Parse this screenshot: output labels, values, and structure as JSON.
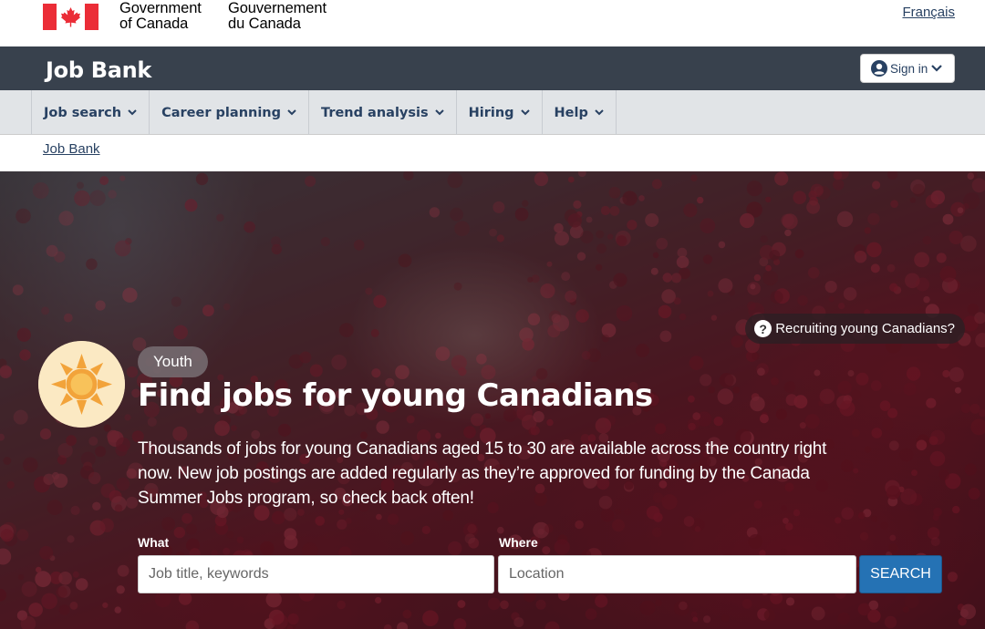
{
  "goc": {
    "name_en_line1": "Government",
    "name_en_line2": "of Canada",
    "name_fr_line1": "Gouvernement",
    "name_fr_line2": "du Canada",
    "language_link": "Français"
  },
  "app": {
    "title": "Job Bank",
    "signin_label": "Sign in"
  },
  "menu": {
    "items": [
      {
        "label": "Job search"
      },
      {
        "label": "Career planning"
      },
      {
        "label": "Trend analysis"
      },
      {
        "label": "Hiring"
      },
      {
        "label": "Help"
      }
    ]
  },
  "breadcrumb": {
    "home": "Job Bank"
  },
  "hero": {
    "recruit_label": "Recruiting young Canadians?",
    "tag": "Youth",
    "title": "Find jobs for young Canadians",
    "description": "Thousands of jobs for young Canadians aged 15 to 30 are available across the country right now. New job postings are added regularly as they’re approved for funding by the Canada Summer Jobs program, so check back often!"
  },
  "search": {
    "what_label": "What",
    "what_placeholder": "Job title, keywords",
    "where_label": "Where",
    "where_placeholder": "Location",
    "button_label": "SEARCH"
  },
  "colors": {
    "app_bar": "#38414d",
    "menu_bar": "#e1e4e7",
    "link": "#284162",
    "search_button": "#2572b4",
    "flag_red": "#eb2d37"
  }
}
